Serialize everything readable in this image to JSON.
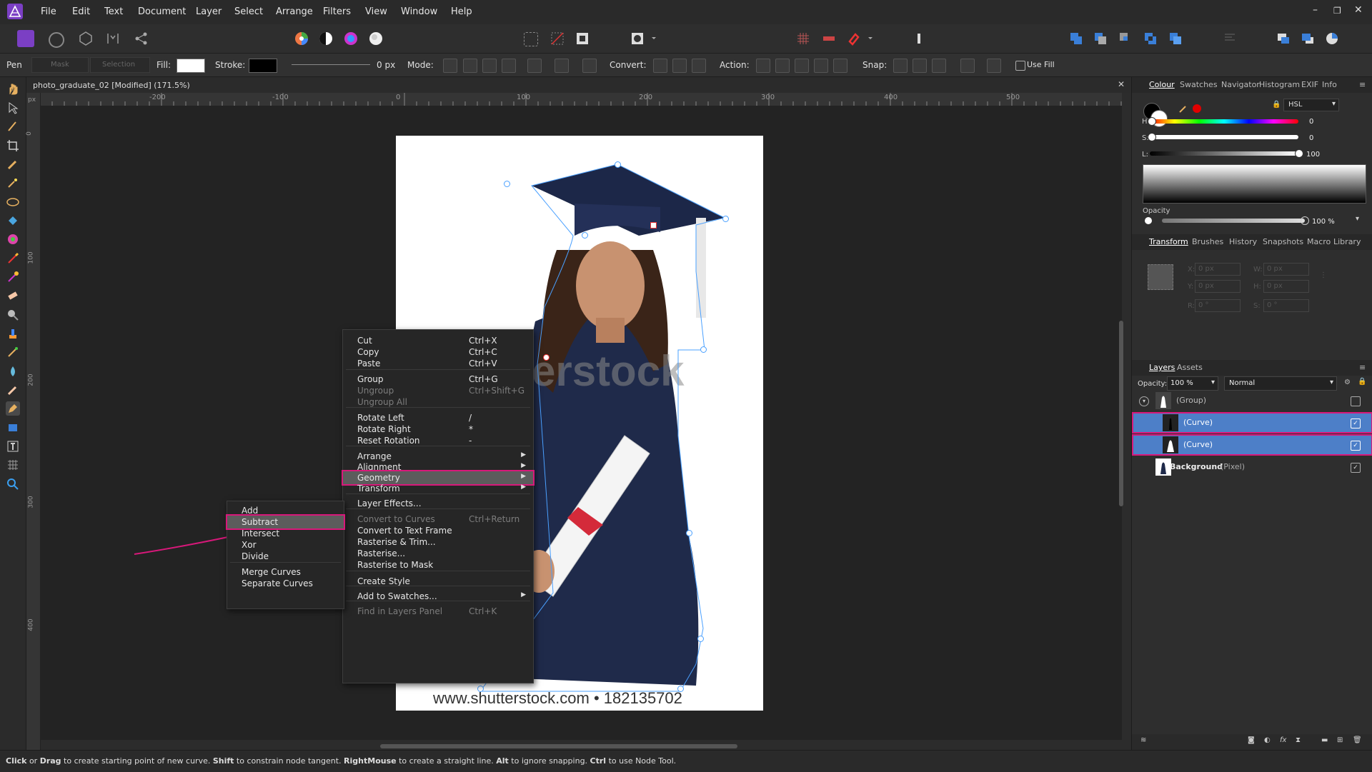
{
  "menubar": {
    "items": [
      "File",
      "Edit",
      "Text",
      "Document",
      "Layer",
      "Select",
      "Arrange",
      "Filters",
      "View",
      "Window",
      "Help"
    ]
  },
  "context_toolbar": {
    "tool": "Pen",
    "mask": "Mask",
    "selection": "Selection",
    "fill_label": "Fill:",
    "stroke_label": "Stroke:",
    "stroke_width": "0 px",
    "mode_label": "Mode:",
    "convert_label": "Convert:",
    "action_label": "Action:",
    "snap_label": "Snap:",
    "use_fill": "Use Fill",
    "fill_color": "#ffffff",
    "stroke_color": "#000000"
  },
  "document": {
    "tab_title": "photo_graduate_02 [Modified] (171.5%)",
    "ruler_unit": "px",
    "ruler_top_ticks": [
      "-200",
      "-100",
      "0",
      "100",
      "200",
      "300",
      "400",
      "500"
    ],
    "ruler_left_ticks": [
      "0",
      "100",
      "200",
      "300",
      "400"
    ],
    "watermark": "terstock",
    "footer": "www.shutterstock.com • 182135702"
  },
  "context_menu": {
    "items": [
      {
        "label": "Cut",
        "shortcut": "Ctrl+X",
        "disabled": false
      },
      {
        "label": "Copy",
        "shortcut": "Ctrl+C",
        "disabled": false
      },
      {
        "label": "Paste",
        "shortcut": "Ctrl+V",
        "disabled": false
      },
      {
        "label": "Group",
        "shortcut": "Ctrl+G",
        "disabled": false
      },
      {
        "label": "Ungroup",
        "shortcut": "Ctrl+Shift+G",
        "disabled": true
      },
      {
        "label": "Ungroup All",
        "shortcut": "",
        "disabled": true
      },
      {
        "label": "Rotate Left",
        "shortcut": "/",
        "disabled": false
      },
      {
        "label": "Rotate Right",
        "shortcut": "*",
        "disabled": false
      },
      {
        "label": "Reset Rotation",
        "shortcut": "-",
        "disabled": false
      },
      {
        "label": "Arrange",
        "shortcut": "",
        "disabled": false
      },
      {
        "label": "Alignment",
        "shortcut": "",
        "disabled": false
      },
      {
        "label": "Geometry",
        "shortcut": "",
        "disabled": false
      },
      {
        "label": "Transform",
        "shortcut": "",
        "disabled": false
      },
      {
        "label": "Layer Effects...",
        "shortcut": "",
        "disabled": false
      },
      {
        "label": "Convert to Curves",
        "shortcut": "Ctrl+Return",
        "disabled": true
      },
      {
        "label": "Convert to Text Frame",
        "shortcut": "",
        "disabled": false
      },
      {
        "label": "Rasterise & Trim...",
        "shortcut": "",
        "disabled": false
      },
      {
        "label": "Rasterise...",
        "shortcut": "",
        "disabled": false
      },
      {
        "label": "Rasterise to Mask",
        "shortcut": "",
        "disabled": false
      },
      {
        "label": "Create Style",
        "shortcut": "",
        "disabled": false
      },
      {
        "label": "Add to Swatches...",
        "shortcut": "",
        "disabled": false
      },
      {
        "label": "Find in Layers Panel",
        "shortcut": "Ctrl+K",
        "disabled": true
      }
    ]
  },
  "geometry_submenu": {
    "items": [
      "Add",
      "Subtract",
      "Intersect",
      "Xor",
      "Divide",
      "Merge Curves",
      "Separate Curves"
    ],
    "highlighted": "Subtract"
  },
  "colour_panel": {
    "tabs": [
      "Colour",
      "Swatches",
      "Navigator",
      "Histogram",
      "EXIF",
      "Info"
    ],
    "model": "HSL",
    "h_label": "H:",
    "h_value": "0",
    "s_label": "S:",
    "s_value": "0",
    "l_label": "L:",
    "l_value": "100",
    "opacity_label": "Opacity",
    "opacity_value": "100 %"
  },
  "transform_panel": {
    "tabs": [
      "Transform",
      "Brushes",
      "History",
      "Snapshots",
      "Macro",
      "Library"
    ],
    "x_label": "X:",
    "x": "0 px",
    "y_label": "Y:",
    "y": "0 px",
    "w_label": "W:",
    "w": "0 px",
    "h_label": "H:",
    "h": "0 px",
    "r_label": "R:",
    "r": "0 °",
    "s_label": "S:",
    "s": "0 °"
  },
  "layers_panel": {
    "tabs": [
      "Layers",
      "Assets"
    ],
    "opacity_label": "Opacity:",
    "opacity_value": "100 %",
    "blend_mode": "Normal",
    "layers": [
      {
        "name": "(Group)",
        "type": "",
        "selected": false
      },
      {
        "name": "(Curve)",
        "type": "",
        "selected": true
      },
      {
        "name": "(Curve)",
        "type": "",
        "selected": true
      },
      {
        "name": "Background",
        "type": "(Pixel)",
        "selected": false
      }
    ]
  },
  "statusbar": {
    "parts": [
      {
        "text": "Click",
        "bold": true
      },
      {
        "text": " or ",
        "bold": false
      },
      {
        "text": "Drag",
        "bold": true
      },
      {
        "text": " to create starting point of new curve. ",
        "bold": false
      },
      {
        "text": "Shift",
        "bold": true
      },
      {
        "text": " to constrain node tangent. ",
        "bold": false
      },
      {
        "text": "RightMouse",
        "bold": true
      },
      {
        "text": " to create a straight line. ",
        "bold": false
      },
      {
        "text": "Alt",
        "bold": true
      },
      {
        "text": " to ignore snapping. ",
        "bold": false
      },
      {
        "text": "Ctrl",
        "bold": true
      },
      {
        "text": " to use Node Tool.",
        "bold": false
      }
    ]
  },
  "colors": {
    "accent_highlight": "#d8187a",
    "selection_blue": "#4d7fc8",
    "brand_purple": "#8e44c8"
  }
}
